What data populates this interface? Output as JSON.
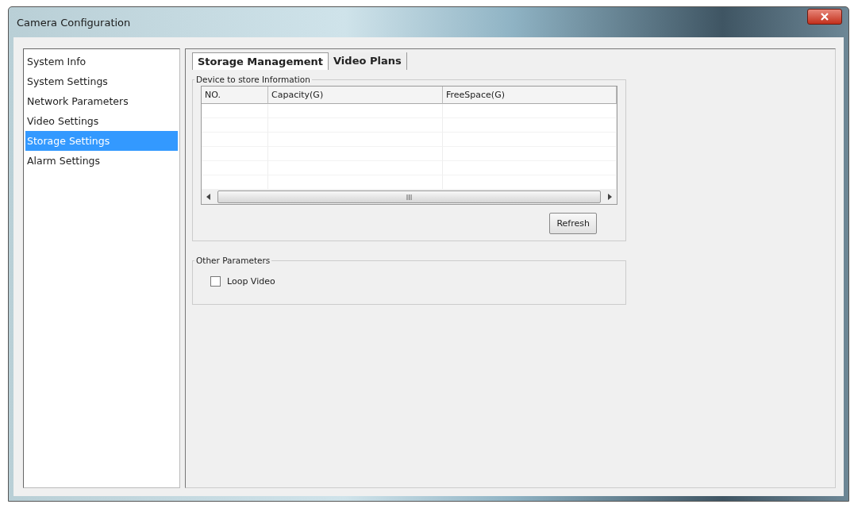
{
  "window": {
    "title": "Camera Configuration"
  },
  "sidebar": {
    "items": [
      {
        "label": "System Info",
        "selected": false
      },
      {
        "label": "System Settings",
        "selected": false
      },
      {
        "label": "Network Parameters",
        "selected": false
      },
      {
        "label": "Video Settings",
        "selected": false
      },
      {
        "label": "Storage Settings",
        "selected": true
      },
      {
        "label": "Alarm Settings",
        "selected": false
      }
    ]
  },
  "tabs": [
    {
      "label": "Storage Management",
      "selected": true
    },
    {
      "label": "Video Plans",
      "selected": false
    }
  ],
  "device_group": {
    "title": "Device to store Information",
    "table": {
      "columns": [
        "NO.",
        "Capacity(G)",
        "FreeSpace(G)"
      ]
    },
    "refresh_button": "Refresh"
  },
  "other_group": {
    "title": "Other Parameters",
    "loop_video": {
      "label": "Loop Video",
      "checked": false
    }
  }
}
